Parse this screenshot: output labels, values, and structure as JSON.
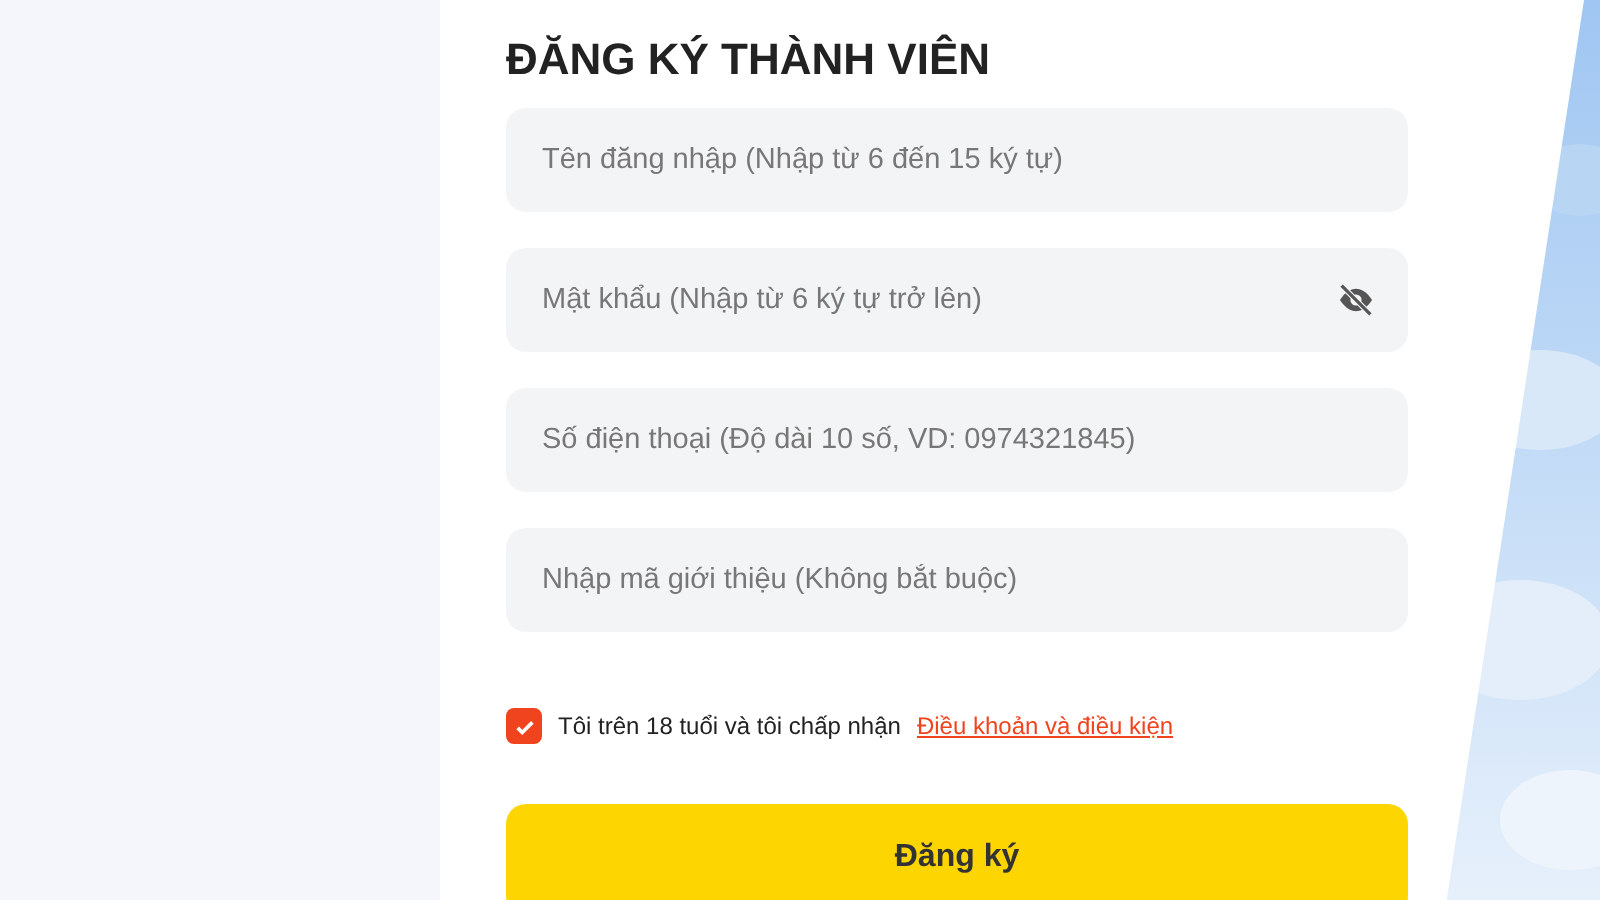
{
  "title": "ĐĂNG KÝ THÀNH VIÊN",
  "fields": [
    {
      "kind": "text",
      "placeholder": "Tên đăng nhập (Nhập từ 6 đến 15 ký tự)"
    },
    {
      "kind": "password",
      "placeholder": "Mật khẩu (Nhập từ 6 ký tự trở lên)"
    },
    {
      "kind": "text",
      "placeholder": "Số điện thoại (Độ dài 10 số, VD: 0974321845)"
    },
    {
      "kind": "text",
      "placeholder": "Nhập mã giới thiệu (Không bắt buộc)"
    }
  ],
  "agreement": {
    "checked": true,
    "text": "Tôi trên 18 tuổi và tôi chấp nhận",
    "link": "Điều khoản và điều kiện"
  },
  "submit": "Đăng ký"
}
